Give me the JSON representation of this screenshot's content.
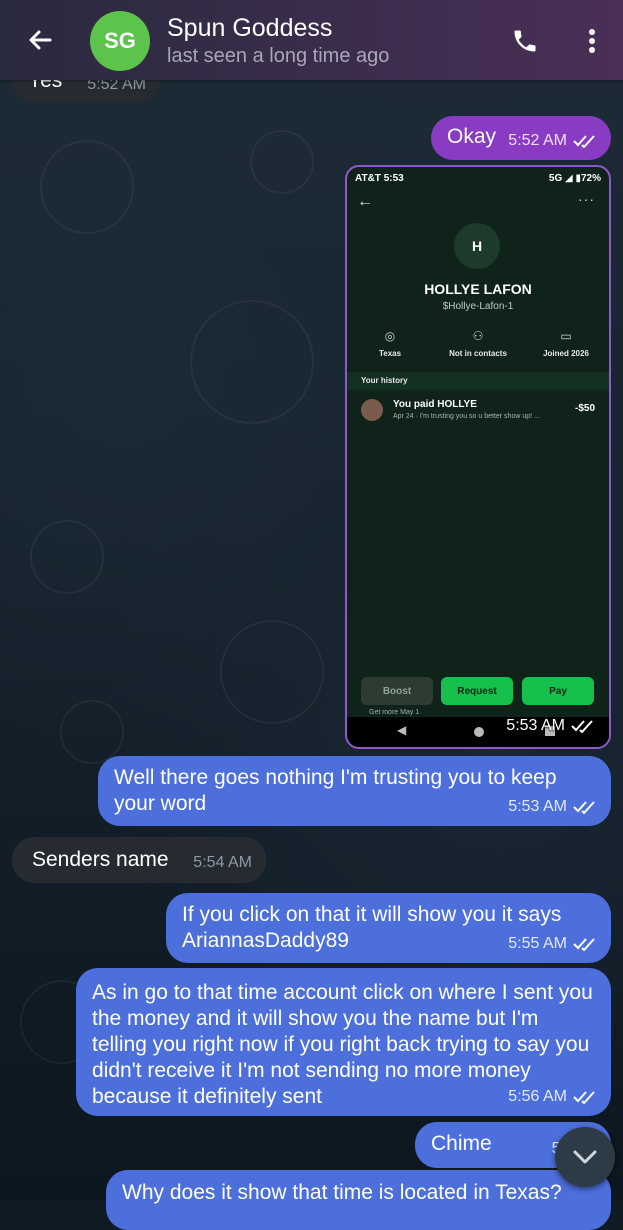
{
  "header": {
    "avatar_initials": "SG",
    "title": "Spun Goddess",
    "subtitle": "last seen a long time ago"
  },
  "colors": {
    "header_start": "#2a2a3e",
    "header_end": "#4a2f57",
    "avatar": "#5cc44a",
    "incoming": "#262b31",
    "outgoing_purple": "#8a3bc4",
    "outgoing_blue": "#4c6fdb"
  },
  "messages": [
    {
      "text": "Yes",
      "time": "5:52 AM",
      "direction": "in"
    },
    {
      "text": "Okay",
      "time": "5:52 AM",
      "direction": "out"
    },
    {
      "text": "",
      "time": "5:53 AM",
      "direction": "out",
      "type": "image"
    },
    {
      "text": "Well there goes nothing I'm trusting you to keep your word",
      "time": "5:53 AM",
      "direction": "out"
    },
    {
      "text": "Senders name",
      "time": "5:54 AM",
      "direction": "in"
    },
    {
      "text": "If you click on that it will show you it says AriannasDaddy89",
      "time": "5:55 AM",
      "direction": "out"
    },
    {
      "text": "As in go to that time account click on where I sent you the money and it will show you the name but I'm telling you right now if you right back trying to say you didn't receive it I'm not sending no more money because it definitely sent",
      "time": "5:56 AM",
      "direction": "out"
    },
    {
      "text": "Chime",
      "time": "5:56 A",
      "direction": "out"
    },
    {
      "text": "Why does it show that time is located in Texas?",
      "time": "",
      "direction": "out"
    }
  ],
  "screenshot": {
    "carrier": "AT&T 5:53",
    "status_right": "5G ◢ ▮72%",
    "avatar_letter": "H",
    "name": "HOLLYE LAFON",
    "handle": "$Hollye-Lafon-1",
    "columns": [
      {
        "icon": "location-icon",
        "label": "Texas"
      },
      {
        "icon": "people-icon",
        "label": "Not in contacts"
      },
      {
        "icon": "card-icon",
        "label": "Joined 2026"
      }
    ],
    "history_label": "Your history",
    "payment_title": "You paid HOLLYE",
    "payment_sub": "Apr 24 · I'm trusting you so u better show up! ...",
    "payment_amount": "-$50",
    "btn_boost": "Boost",
    "btn_request": "Request",
    "btn_pay": "Pay",
    "more_text": "Get more May 1"
  }
}
